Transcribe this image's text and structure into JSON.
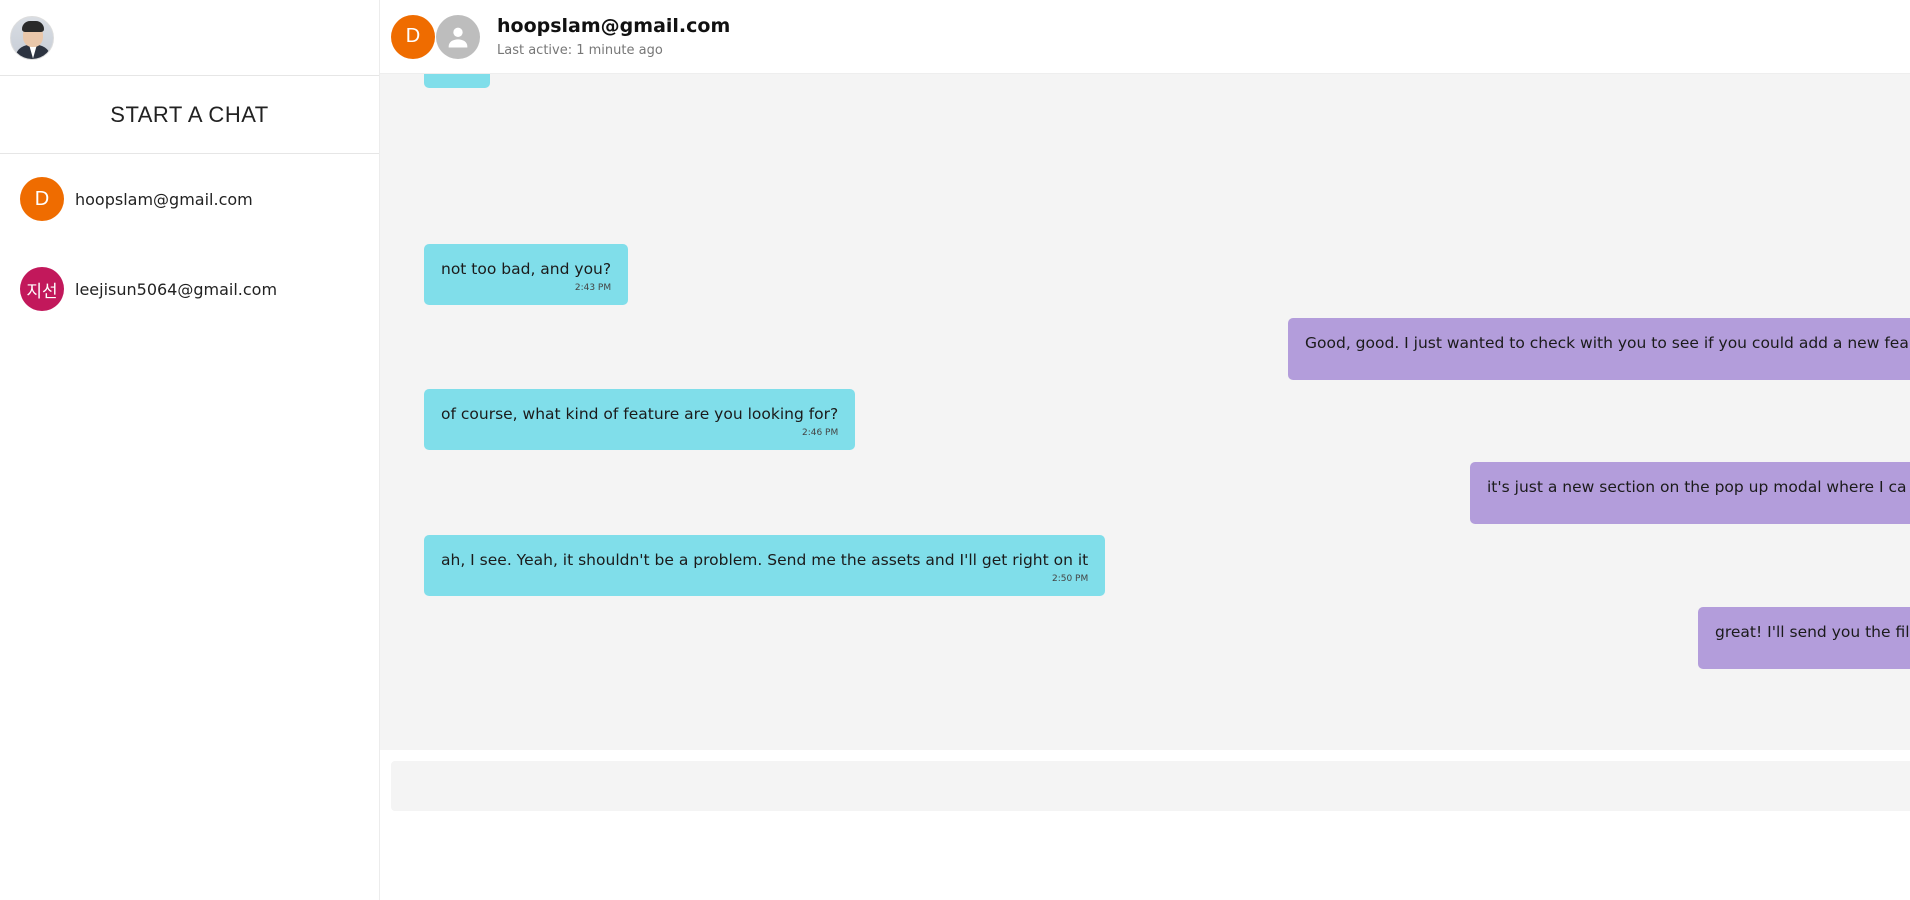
{
  "sidebar": {
    "start_chat_label": "START A CHAT",
    "contacts": [
      {
        "avatar_text": "D",
        "avatar_color": "#ef6c00",
        "email": "hoopslam@gmail.com"
      },
      {
        "avatar_text": "지선",
        "avatar_color": "#c2185b",
        "email": "leejisun5064@gmail.com"
      }
    ]
  },
  "chat": {
    "header": {
      "avatar_text": "D",
      "avatar_color": "#ef6c00",
      "title": "hoopslam@gmail.com",
      "subtitle": "Last active: 1 minute ago"
    },
    "messages": [
      {
        "direction": "in",
        "text": "not too bad, and you?",
        "time": "2:43 PM"
      },
      {
        "direction": "out",
        "text": "Good, good. I just wanted to check with you to see if you could add a new fea",
        "time": ""
      },
      {
        "direction": "in",
        "text": "of course, what kind of feature are you looking for?",
        "time": "2:46 PM"
      },
      {
        "direction": "out",
        "text": "it's just a new section on the pop up modal where I ca",
        "time": ""
      },
      {
        "direction": "in",
        "text": "ah, I see. Yeah, it shouldn't be a problem. Send me the assets and I'll get right on it",
        "time": "2:50 PM"
      },
      {
        "direction": "out",
        "text": "great! I'll send you the fil",
        "time": ""
      }
    ],
    "composer": {
      "placeholder": ""
    }
  },
  "colors": {
    "incoming_bubble": "#80deea",
    "outgoing_bubble": "#b39ddb",
    "messages_background": "#f4f4f4"
  }
}
